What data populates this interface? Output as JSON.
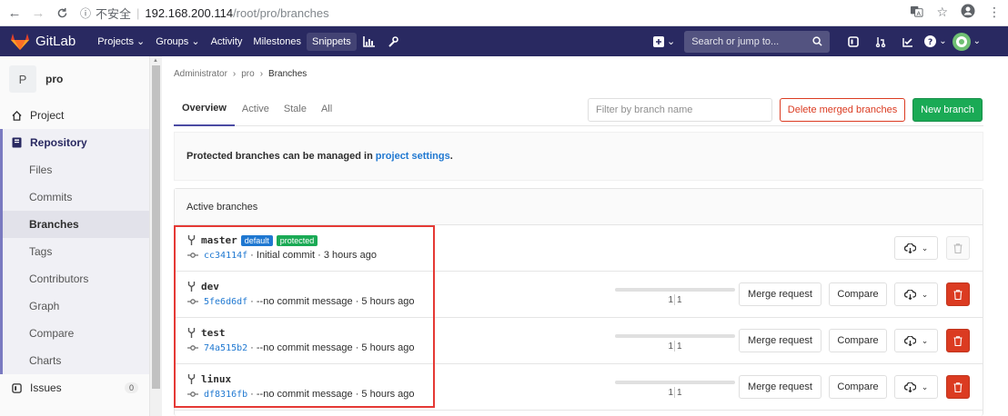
{
  "browser": {
    "security_label": "不安全",
    "url_host": "192.168.200.114",
    "url_path": "/root/pro/branches"
  },
  "header": {
    "brand": "GitLab",
    "nav": [
      {
        "label": "Projects ⌄"
      },
      {
        "label": "Groups ⌄"
      },
      {
        "label": "Activity"
      },
      {
        "label": "Milestones"
      },
      {
        "label": "Snippets"
      }
    ],
    "search_placeholder": "Search or jump to...",
    "colors": {
      "header_bg": "#292961",
      "accent": "#fc6d26"
    }
  },
  "sidebar": {
    "project_initial": "P",
    "project_name": "pro",
    "project_label": "Project",
    "repository_label": "Repository",
    "sub_items": [
      "Files",
      "Commits",
      "Branches",
      "Tags",
      "Contributors",
      "Graph",
      "Compare",
      "Charts"
    ],
    "active_item": "Branches",
    "issues_label": "Issues",
    "issues_count": "0"
  },
  "breadcrumb": {
    "items": [
      "Administrator",
      "pro",
      "Branches"
    ],
    "separator": "›"
  },
  "tabs": [
    "Overview",
    "Active",
    "Stale",
    "All"
  ],
  "filter_placeholder": "Filter by branch name",
  "buttons": {
    "delete_merged": "Delete merged branches",
    "new_branch": "New branch",
    "merge_request": "Merge request",
    "compare": "Compare"
  },
  "notice": {
    "text": "Protected branches can be managed in",
    "link": "project settings",
    "end": "."
  },
  "panel_title": "Active branches",
  "branches": [
    {
      "name": "master",
      "labels": [
        "default",
        "protected"
      ],
      "sha": "cc34114f",
      "message": "· Initial commit · 3 hours ago",
      "behind": "",
      "ahead": "",
      "show_actions": false
    },
    {
      "name": "dev",
      "labels": [],
      "sha": "5fe6d6df",
      "message": "· --no commit message · 5 hours ago",
      "behind": "1",
      "ahead": "1",
      "show_actions": true
    },
    {
      "name": "test",
      "labels": [],
      "sha": "74a515b2",
      "message": "· --no commit message · 5 hours ago",
      "behind": "1",
      "ahead": "1",
      "show_actions": true
    },
    {
      "name": "linux",
      "labels": [],
      "sha": "df8316fb",
      "message": "· --no commit message · 5 hours ago",
      "behind": "1",
      "ahead": "1",
      "show_actions": true
    }
  ]
}
